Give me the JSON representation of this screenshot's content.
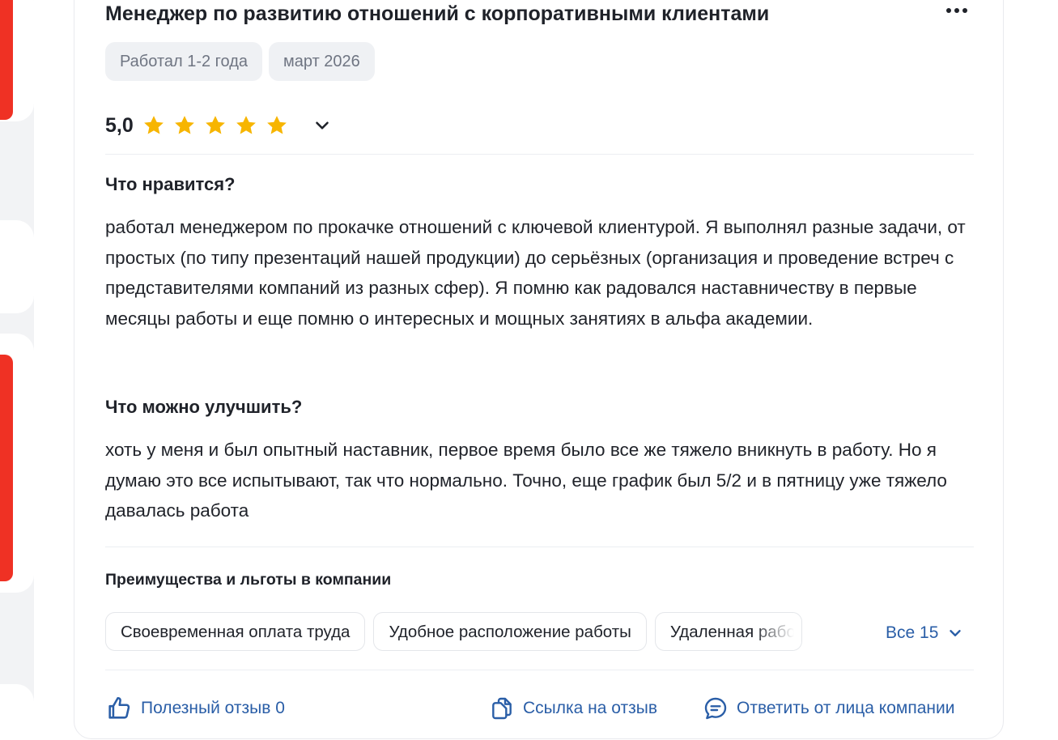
{
  "review": {
    "title": "Менеджер по развитию отношений с корпоративными клиентами",
    "tags": [
      "Работал 1-2 года",
      "март 2026"
    ],
    "rating": {
      "value_label": "5,0",
      "stars": 5,
      "max_stars": 5
    },
    "likes": {
      "title": "Что нравится?",
      "text": "работал менеджером по прокачке отношений с ключевой клиентурой. Я выполнял разные задачи, от простых (по типу презентаций нашей продукции) до серьёзных (организация и проведение встреч с представителями компаний из разных сфер). Я помню как радовался наставничеству в первые месяцы работы и еще помню о интересных и мощных занятиях в альфа академии."
    },
    "improve": {
      "title": "Что можно улучшить?",
      "text": "хоть у меня и был опытный наставник, первое время было все же тяжело вникнуть в работу. Но я думаю это все испытывают, так что нормально. Точно, еще график был 5/2 и в пятницу уже тяжело давалась работа"
    },
    "benefits": {
      "title": "Преимущества и льготы в компании",
      "chips": [
        "Своевременная оплата труда",
        "Удобное расположение работы",
        "Удаленная работа"
      ],
      "all_label": "Все 15"
    },
    "footer": {
      "useful_label": "Полезный отзыв 0",
      "link_label": "Ссылка на отзыв",
      "reply_label": "Ответить от лица компании"
    }
  },
  "colors": {
    "accent_red": "#ef3124",
    "link_blue": "#2a5ea7",
    "star_yellow": "#f7b500",
    "tag_bg": "#eff1f4"
  },
  "icons": {
    "more": "more-dots-icon",
    "star": "star-icon",
    "chevron": "chevron-down-icon",
    "thumb": "thumbs-up-icon",
    "copy": "copy-link-icon",
    "reply": "chat-reply-icon"
  }
}
